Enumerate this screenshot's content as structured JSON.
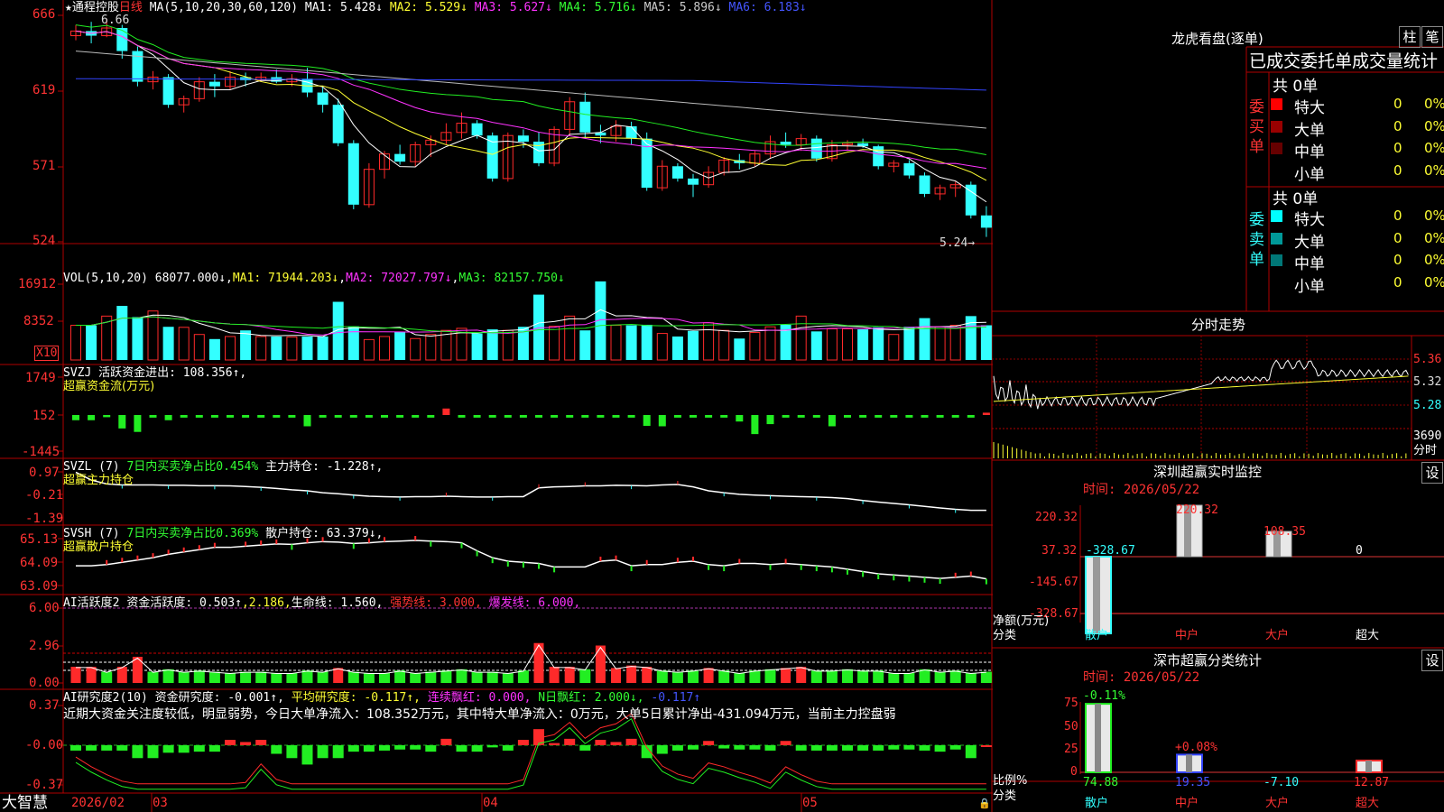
{
  "colors": {
    "up": "#ff2a2a",
    "down": "#33ffff",
    "grid": "#b00000",
    "green": "#22ee22",
    "yellow": "#ffff33",
    "magenta": "#ff33ff",
    "blue": "#3344ff",
    "white": "#ffffff"
  },
  "kline": {
    "header": {
      "star": "★",
      "stock": "通程控股",
      "period": "日线",
      "ma_params": "MA(5,10,20,30,60,120)",
      "ma1": "MA1: 5.428↓",
      "ma2": "MA2: 5.529↓",
      "ma3": "MA3: 5.627↓",
      "ma4": "MA4: 5.716↓",
      "ma5": "MA5: 5.896↓",
      "ma6": "MA6: 6.183↓"
    },
    "yticks": [
      "666",
      "619",
      "571",
      "524"
    ],
    "high_label": "6.66",
    "low_label": "5.24→"
  },
  "volume": {
    "header": "VOL(5,10,20)",
    "vol": "68077.000↓",
    "ma1": "MA1: 71944.203↓",
    "ma2": "MA2: 72027.797↓",
    "ma3": "MA3: 82157.750↓",
    "yticks": [
      "16912",
      "8352"
    ],
    "unit": "X10"
  },
  "svzj": {
    "header": "SVZJ  活跃资金进出: 108.356↑,",
    "sub": "超赢资金流(万元)",
    "yticks": [
      "1749",
      "152",
      "-1445"
    ]
  },
  "svzl": {
    "header_a": "SVZL (7)",
    "header_b": "7日内买卖净占比0.454%",
    "header_c": "主力持仓: -1.228↑,",
    "sub": "超赢主力持仓",
    "yticks": [
      "0.97",
      "-0.21",
      "-1.39"
    ]
  },
  "svsh": {
    "header_a": "SVSH (7)",
    "header_b": "7日内买卖净占比0.369%",
    "header_c": "散户持仓: 63.379↓,",
    "sub": "超赢散户持仓",
    "yticks": [
      "65.13",
      "64.09",
      "63.09"
    ]
  },
  "ai_active": {
    "a": "AI活跃度2",
    "b": "资金活跃度: 0.503↑",
    "c": ",2.186,",
    "d": "生命线: 1.560,",
    "e": "强势线: 3.000,",
    "f": "爆发线: 6.000,",
    "yticks": [
      "6.00",
      "2.96",
      "0.00"
    ]
  },
  "ai_research": {
    "a": "AI研究度2(10)",
    "b": "资金研究度: -0.001↑,",
    "c": "平均研究度: -0.117↑,",
    "d": "连续飘红: 0.000,",
    "e": "N日飘红: 2.000↓,",
    "f": "-0.117↑",
    "comment": "近期大资金关注度较低，明显弱势，今日大单净流入：108.352万元，其中特大单净流入：0万元，大单5日累计净出-431.094万元，当前主力控盘弱",
    "yticks": [
      "0.37",
      "-0.00",
      "-0.37"
    ]
  },
  "xaxis": {
    "brand": "大智慧",
    "labels": [
      "2026/02",
      "03",
      "04",
      "05"
    ]
  },
  "right": {
    "lhkp_title": "龙虎看盘(逐单)",
    "btn_bar": "柱",
    "btn_pen": "笔",
    "stats_title": "已成交委托单成交量统计",
    "buy_label": "委买单",
    "sell_label": "委卖单",
    "buy_total": "共 0单",
    "sell_total": "共 0单",
    "buy_rows": [
      {
        "label": "特大",
        "count": "0",
        "pct": "0%",
        "color": "#ff0000"
      },
      {
        "label": "大单",
        "count": "0",
        "pct": "0%",
        "color": "#990000"
      },
      {
        "label": "中单",
        "count": "0",
        "pct": "0%",
        "color": "#660000"
      },
      {
        "label": "小单",
        "count": "0",
        "pct": "0%",
        "color": ""
      }
    ],
    "sell_rows": [
      {
        "label": "特大",
        "count": "0",
        "pct": "0%",
        "color": "#00ffff"
      },
      {
        "label": "大单",
        "count": "0",
        "pct": "0%",
        "color": "#009999"
      },
      {
        "label": "中单",
        "count": "0",
        "pct": "0%",
        "color": "#007777"
      },
      {
        "label": "小单",
        "count": "0",
        "pct": "0%",
        "color": ""
      }
    ],
    "minute_title": "分时走势",
    "minute_prices": [
      "5.36",
      "5.32",
      "5.28"
    ],
    "minute_vol": "3690",
    "minute_vol_label": "分时",
    "sz_title": "深圳超赢实时监控",
    "set": "设",
    "date1": "时间: 2026/05/22",
    "net": {
      "yticks": [
        "220.32",
        "37.32",
        "-145.67",
        "-328.67"
      ],
      "bars": [
        {
          "cat": "散户",
          "value": -328.67,
          "label": "-328.67"
        },
        {
          "cat": "中户",
          "value": 220.32,
          "label": "220.32"
        },
        {
          "cat": "大户",
          "value": 108.35,
          "label": "108.35"
        },
        {
          "cat": "超大",
          "value": 0,
          "label": "0"
        }
      ],
      "unit": "净额(万元)",
      "class": "分类"
    },
    "cls_title": "深市超赢分类统计",
    "date2": "时间: 2026/05/22",
    "ratio": {
      "yticks": [
        "75",
        "50",
        "25",
        "0"
      ],
      "bars": [
        {
          "cat": "散户",
          "value": 74.88,
          "delta": "-0.11%"
        },
        {
          "cat": "中户",
          "value": 19.35,
          "delta": "+0.08%"
        },
        {
          "cat": "大户",
          "value": -7.1,
          "delta": ""
        },
        {
          "cat": "超大",
          "value": 12.87,
          "delta": ""
        }
      ],
      "values_text": [
        "74.88",
        "19.35",
        "-7.10",
        "12.87"
      ],
      "unit": "比例%",
      "class": "分类"
    }
  },
  "chart_data": {
    "type": "candlestick",
    "ohlc": [
      [
        6.55,
        6.62,
        6.52,
        6.58
      ],
      [
        6.58,
        6.64,
        6.5,
        6.55
      ],
      [
        6.55,
        6.66,
        6.54,
        6.6
      ],
      [
        6.6,
        6.62,
        6.4,
        6.45
      ],
      [
        6.45,
        6.48,
        6.22,
        6.25
      ],
      [
        6.25,
        6.32,
        6.2,
        6.28
      ],
      [
        6.28,
        6.3,
        6.08,
        6.1
      ],
      [
        6.1,
        6.16,
        6.05,
        6.14
      ],
      [
        6.14,
        6.28,
        6.12,
        6.25
      ],
      [
        6.25,
        6.3,
        6.15,
        6.22
      ],
      [
        6.22,
        6.32,
        6.2,
        6.28
      ],
      [
        6.28,
        6.31,
        6.22,
        6.26
      ],
      [
        6.26,
        6.31,
        6.25,
        6.28
      ],
      [
        6.28,
        6.33,
        6.24,
        6.25
      ],
      [
        6.25,
        6.3,
        6.22,
        6.27
      ],
      [
        6.27,
        6.34,
        6.15,
        6.18
      ],
      [
        6.18,
        6.22,
        6.05,
        6.1
      ],
      [
        6.1,
        6.14,
        5.83,
        5.85
      ],
      [
        5.85,
        5.87,
        5.42,
        5.45
      ],
      [
        5.45,
        5.72,
        5.43,
        5.68
      ],
      [
        5.68,
        5.8,
        5.62,
        5.78
      ],
      [
        5.78,
        5.84,
        5.71,
        5.73
      ],
      [
        5.73,
        5.86,
        5.7,
        5.84
      ],
      [
        5.84,
        5.9,
        5.76,
        5.87
      ],
      [
        5.87,
        5.98,
        5.84,
        5.92
      ],
      [
        5.92,
        6.05,
        5.88,
        5.98
      ],
      [
        5.98,
        6.0,
        5.88,
        5.9
      ],
      [
        5.9,
        5.92,
        5.6,
        5.62
      ],
      [
        5.62,
        5.92,
        5.6,
        5.9
      ],
      [
        5.9,
        5.94,
        5.82,
        5.86
      ],
      [
        5.86,
        5.92,
        5.7,
        5.72
      ],
      [
        5.72,
        5.96,
        5.7,
        5.94
      ],
      [
        5.94,
        6.15,
        5.9,
        6.12
      ],
      [
        6.12,
        6.18,
        5.88,
        5.92
      ],
      [
        5.92,
        5.97,
        5.85,
        5.9
      ],
      [
        5.9,
        6.0,
        5.86,
        5.96
      ],
      [
        5.96,
        5.99,
        5.84,
        5.88
      ],
      [
        5.88,
        5.92,
        5.54,
        5.56
      ],
      [
        5.56,
        5.74,
        5.54,
        5.7
      ],
      [
        5.7,
        5.72,
        5.6,
        5.62
      ],
      [
        5.62,
        5.65,
        5.5,
        5.58
      ],
      [
        5.58,
        5.7,
        5.56,
        5.66
      ],
      [
        5.66,
        5.76,
        5.64,
        5.74
      ],
      [
        5.74,
        5.78,
        5.68,
        5.72
      ],
      [
        5.72,
        5.8,
        5.7,
        5.78
      ],
      [
        5.78,
        5.9,
        5.75,
        5.86
      ],
      [
        5.86,
        5.92,
        5.82,
        5.84
      ],
      [
        5.84,
        5.91,
        5.8,
        5.88
      ],
      [
        5.88,
        5.9,
        5.73,
        5.75
      ],
      [
        5.75,
        5.87,
        5.73,
        5.84
      ],
      [
        5.84,
        5.87,
        5.8,
        5.85
      ],
      [
        5.85,
        5.88,
        5.82,
        5.83
      ],
      [
        5.83,
        5.84,
        5.68,
        5.7
      ],
      [
        5.7,
        5.74,
        5.66,
        5.72
      ],
      [
        5.72,
        5.74,
        5.62,
        5.64
      ],
      [
        5.64,
        5.66,
        5.5,
        5.52
      ],
      [
        5.52,
        5.58,
        5.48,
        5.56
      ],
      [
        5.56,
        5.6,
        5.5,
        5.58
      ],
      [
        5.58,
        5.6,
        5.36,
        5.38
      ],
      [
        5.38,
        5.44,
        5.24,
        5.3
      ]
    ],
    "volume": [
      6800,
      6800,
      8600,
      10600,
      8400,
      9600,
      6500,
      6400,
      5000,
      4100,
      4600,
      5800,
      4600,
      4600,
      4500,
      4600,
      4600,
      11400,
      6600,
      4000,
      4600,
      5500,
      4200,
      5000,
      5800,
      6200,
      5200,
      6000,
      5800,
      6500,
      12800,
      6600,
      8600,
      5800,
      15400,
      6800,
      6800,
      6900,
      5200,
      4600,
      5700,
      7300,
      5800,
      4200,
      5400,
      6500,
      6900,
      8600,
      5600,
      6100,
      6100,
      6000,
      6400,
      5000,
      6500,
      8200,
      6500,
      6800,
      8600,
      6800
    ],
    "svzj": [
      -240,
      -240,
      -100,
      -620,
      -780,
      -120,
      -240,
      -120,
      -120,
      -120,
      -120,
      -120,
      -120,
      -120,
      -120,
      -520,
      -120,
      -120,
      -120,
      -120,
      -120,
      -120,
      -120,
      -120,
      300,
      -120,
      -120,
      -120,
      -120,
      -120,
      -120,
      -120,
      -120,
      -120,
      -120,
      -120,
      -120,
      -500,
      -520,
      -120,
      -120,
      -120,
      -120,
      -300,
      -880,
      -420,
      -120,
      -120,
      -120,
      -520,
      -120,
      -120,
      -120,
      -120,
      -120,
      -120,
      -120,
      -120,
      -120,
      108
    ],
    "svzl": [
      0.95,
      0.55,
      0.35,
      0.3,
      0.3,
      0.3,
      0.28,
      0.28,
      0.26,
      0.26,
      0.25,
      0.22,
      0.18,
      0.12,
      0.05,
      0.0,
      -0.1,
      -0.15,
      -0.22,
      -0.28,
      -0.3,
      -0.32,
      -0.3,
      -0.3,
      -0.28,
      -0.3,
      -0.32,
      -0.32,
      -0.3,
      -0.3,
      0.15,
      0.2,
      0.22,
      0.25,
      0.25,
      0.28,
      0.27,
      0.25,
      0.3,
      0.32,
      0.2,
      0.0,
      -0.1,
      -0.18,
      -0.22,
      -0.25,
      -0.28,
      -0.3,
      -0.32,
      -0.35,
      -0.4,
      -0.5,
      -0.58,
      -0.65,
      -0.72,
      -0.8,
      -0.88,
      -0.95,
      -1.0,
      -1.0
    ],
    "svsh": [
      63.95,
      63.95,
      64.0,
      64.1,
      64.2,
      64.3,
      64.45,
      64.55,
      64.65,
      64.75,
      64.75,
      64.8,
      64.85,
      64.9,
      64.88,
      64.95,
      65.0,
      64.98,
      64.92,
      64.95,
      65.0,
      65.02,
      65.05,
      65.02,
      65.0,
      64.95,
      64.6,
      64.3,
      64.15,
      64.1,
      64.05,
      63.9,
      63.9,
      63.9,
      64.15,
      64.2,
      63.95,
      64.0,
      64.0,
      64.1,
      64.15,
      64.0,
      63.95,
      64.05,
      64.05,
      64.0,
      64.05,
      64.0,
      63.95,
      63.9,
      63.8,
      63.7,
      63.6,
      63.55,
      63.5,
      63.45,
      63.4,
      63.45,
      63.5,
      63.38
    ],
    "active": [
      1.3,
      1.3,
      0.9,
      1.3,
      2.1,
      0.9,
      1.1,
      0.9,
      1.0,
      0.9,
      0.8,
      0.9,
      0.9,
      0.8,
      0.8,
      1.0,
      0.9,
      1.2,
      0.9,
      0.8,
      0.8,
      1.0,
      0.8,
      0.9,
      1.0,
      1.1,
      0.9,
      0.9,
      0.8,
      1.0,
      3.2,
      1.3,
      1.3,
      1.1,
      3.0,
      1.2,
      1.4,
      1.3,
      1.0,
      0.9,
      1.0,
      1.2,
      1.0,
      0.8,
      1.0,
      1.1,
      1.2,
      1.3,
      1.0,
      1.0,
      1.1,
      1.0,
      1.0,
      0.8,
      0.8,
      1.1,
      0.9,
      1.0,
      0.8,
      0.9
    ],
    "research": [
      -0.05,
      -0.05,
      -0.05,
      -0.05,
      -0.12,
      -0.12,
      -0.07,
      -0.07,
      -0.06,
      -0.06,
      0.05,
      0.03,
      0.05,
      -0.08,
      -0.12,
      -0.18,
      -0.12,
      -0.12,
      -0.06,
      -0.06,
      -0.05,
      -0.04,
      -0.04,
      -0.06,
      0.06,
      -0.06,
      -0.06,
      -0.02,
      -0.05,
      0.05,
      0.15,
      0.02,
      0.06,
      -0.05,
      0.05,
      0.03,
      0.06,
      -0.12,
      -0.08,
      -0.05,
      -0.04,
      0.04,
      -0.03,
      -0.04,
      -0.04,
      -0.05,
      0.04,
      -0.05,
      -0.05,
      -0.05,
      -0.05,
      -0.05,
      -0.05,
      -0.04,
      -0.04,
      -0.05,
      -0.06,
      -0.04,
      -0.12,
      0.0
    ]
  }
}
